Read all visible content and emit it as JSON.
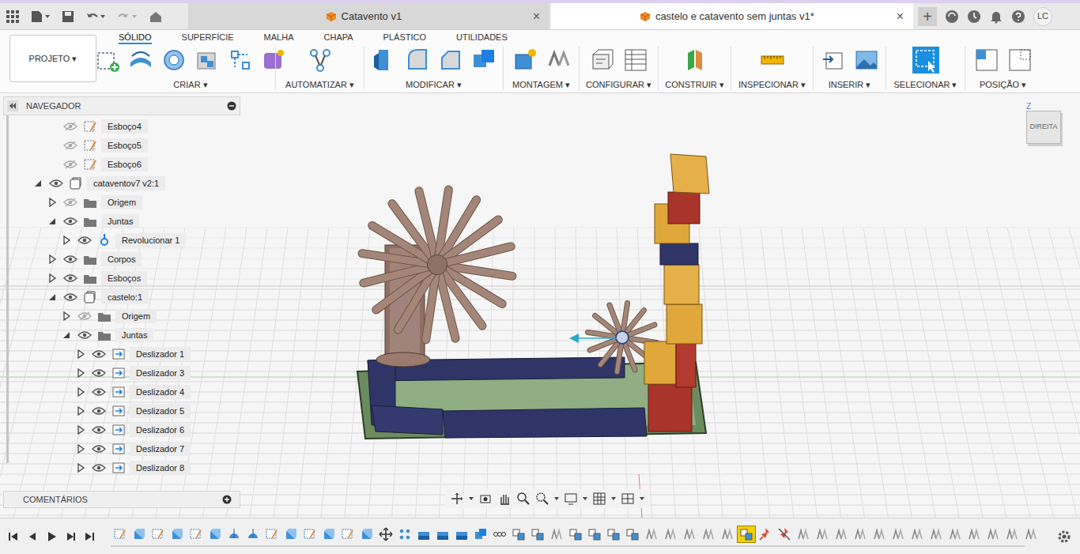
{
  "title_bar": {
    "tabs": [
      {
        "label": "Catavento v1",
        "selected": false,
        "close": "×"
      },
      {
        "label": "castelo e catavento sem juntas v1*",
        "selected": true,
        "close": "×"
      }
    ],
    "new_tab": "+",
    "user": "LC"
  },
  "toolbar": {
    "project": "PROJETO ▾",
    "workspace_tabs": [
      {
        "label": "SÓLIDO",
        "selected": true
      },
      {
        "label": "SUPERFÍCIE",
        "selected": false
      },
      {
        "label": "MALHA",
        "selected": false
      },
      {
        "label": "CHAPA",
        "selected": false
      },
      {
        "label": "PLÁSTICO",
        "selected": false
      },
      {
        "label": "UTILIDADES",
        "selected": false
      }
    ],
    "groups": [
      {
        "label": "CRIAR ▾",
        "selected": false
      },
      {
        "label": "AUTOMATIZAR ▾",
        "selected": false
      },
      {
        "label": "MODIFICAR ▾",
        "selected": false
      },
      {
        "label": "MONTAGEM ▾",
        "selected": false
      },
      {
        "label": "CONFIGURAR ▾",
        "selected": false
      },
      {
        "label": "CONSTRUIR ▾",
        "selected": false
      },
      {
        "label": "INSPECIONAR ▾",
        "selected": false
      },
      {
        "label": "INSERIR ▾",
        "selected": false
      },
      {
        "label": "SELECIONAR ▾",
        "selected": true
      },
      {
        "label": "POSIÇÃO ▾",
        "selected": false
      }
    ]
  },
  "browser": {
    "title": "NAVEGADOR",
    "items": [
      {
        "label": "Esboço4",
        "level": 2,
        "kind": "sketch",
        "visible": false
      },
      {
        "label": "Esboço5",
        "level": 2,
        "kind": "sketch",
        "visible": false
      },
      {
        "label": "Esboço6",
        "level": 2,
        "kind": "sketch",
        "visible": false
      },
      {
        "label": "cataventov7 v2:1",
        "level": 1,
        "kind": "component",
        "visible": true,
        "expanded": true
      },
      {
        "label": "Origem",
        "level": 2,
        "kind": "folder",
        "visible": false,
        "expanded": false
      },
      {
        "label": "Juntas",
        "level": 2,
        "kind": "folder",
        "visible": true,
        "expanded": true
      },
      {
        "label": "Revolucionar 1",
        "level": 3,
        "kind": "joint",
        "visible": true,
        "expanded": false
      },
      {
        "label": "Corpos",
        "level": 2,
        "kind": "folder",
        "visible": true,
        "expanded": false
      },
      {
        "label": "Esboços",
        "level": 2,
        "kind": "folder",
        "visible": true,
        "expanded": false
      },
      {
        "label": "castelo:1",
        "level": 2,
        "kind": "component",
        "visible": true,
        "expanded": true
      },
      {
        "label": "Origem",
        "level": 3,
        "kind": "folder",
        "visible": false,
        "expanded": false
      },
      {
        "label": "Juntas",
        "level": 3,
        "kind": "folder",
        "visible": true,
        "expanded": true
      },
      {
        "label": "Deslizador 1",
        "level": 4,
        "kind": "slider",
        "visible": true,
        "expanded": false
      },
      {
        "label": "Deslizador 3",
        "level": 4,
        "kind": "slider",
        "visible": true,
        "expanded": false
      },
      {
        "label": "Deslizador 4",
        "level": 4,
        "kind": "slider",
        "visible": true,
        "expanded": false
      },
      {
        "label": "Deslizador 5",
        "level": 4,
        "kind": "slider",
        "visible": true,
        "expanded": false
      },
      {
        "label": "Deslizador 6",
        "level": 4,
        "kind": "slider",
        "visible": true,
        "expanded": false
      },
      {
        "label": "Deslizador 7",
        "level": 4,
        "kind": "slider",
        "visible": true,
        "expanded": false
      },
      {
        "label": "Deslizador 8",
        "level": 4,
        "kind": "slider",
        "visible": true,
        "expanded": false
      }
    ]
  },
  "comments": {
    "title": "COMENTÁRIOS"
  },
  "view_cube": {
    "face": "DIREITA",
    "axis": "Z"
  },
  "timeline": {
    "features": [
      {
        "kind": "sketch",
        "selected": false
      },
      {
        "kind": "extrude",
        "selected": false
      },
      {
        "kind": "sketch",
        "selected": false
      },
      {
        "kind": "extrude",
        "selected": false
      },
      {
        "kind": "sketch",
        "selected": false
      },
      {
        "kind": "extrude",
        "selected": false
      },
      {
        "kind": "revolve",
        "selected": false
      },
      {
        "kind": "revolve",
        "selected": false
      },
      {
        "kind": "sketch",
        "selected": false
      },
      {
        "kind": "extrude",
        "selected": false
      },
      {
        "kind": "sketch",
        "selected": false
      },
      {
        "kind": "extrude",
        "selected": false
      },
      {
        "kind": "sketch",
        "selected": false
      },
      {
        "kind": "extrude",
        "selected": false
      },
      {
        "kind": "move",
        "selected": false
      },
      {
        "kind": "pattern",
        "selected": false
      },
      {
        "kind": "body",
        "selected": false
      },
      {
        "kind": "body",
        "selected": false
      },
      {
        "kind": "body",
        "selected": false
      },
      {
        "kind": "combine",
        "selected": false
      },
      {
        "kind": "group",
        "selected": false
      },
      {
        "kind": "joint",
        "selected": false
      },
      {
        "kind": "joint",
        "selected": false
      },
      {
        "kind": "asbuilt",
        "selected": false
      },
      {
        "kind": "joint",
        "selected": false
      },
      {
        "kind": "joint",
        "selected": false
      },
      {
        "kind": "joint",
        "selected": false
      },
      {
        "kind": "joint",
        "selected": false
      },
      {
        "kind": "asbuilt",
        "selected": false
      },
      {
        "kind": "asbuilt",
        "selected": false
      },
      {
        "kind": "asbuilt",
        "selected": false
      },
      {
        "kind": "asbuilt",
        "selected": false
      },
      {
        "kind": "asbuilt",
        "selected": false
      },
      {
        "kind": "joint",
        "selected": true
      },
      {
        "kind": "pin",
        "selected": false
      },
      {
        "kind": "pin-off",
        "selected": false
      },
      {
        "kind": "asbuilt",
        "selected": false
      },
      {
        "kind": "asbuilt",
        "selected": false
      },
      {
        "kind": "asbuilt",
        "selected": false
      },
      {
        "kind": "asbuilt",
        "selected": false
      },
      {
        "kind": "asbuilt",
        "selected": false
      },
      {
        "kind": "asbuilt",
        "selected": false
      },
      {
        "kind": "asbuilt",
        "selected": false
      },
      {
        "kind": "asbuilt",
        "selected": false
      },
      {
        "kind": "asbuilt",
        "selected": false
      },
      {
        "kind": "asbuilt",
        "selected": false
      },
      {
        "kind": "asbuilt",
        "selected": false
      },
      {
        "kind": "asbuilt",
        "selected": false
      },
      {
        "kind": "asbuilt",
        "selected": false
      }
    ]
  }
}
